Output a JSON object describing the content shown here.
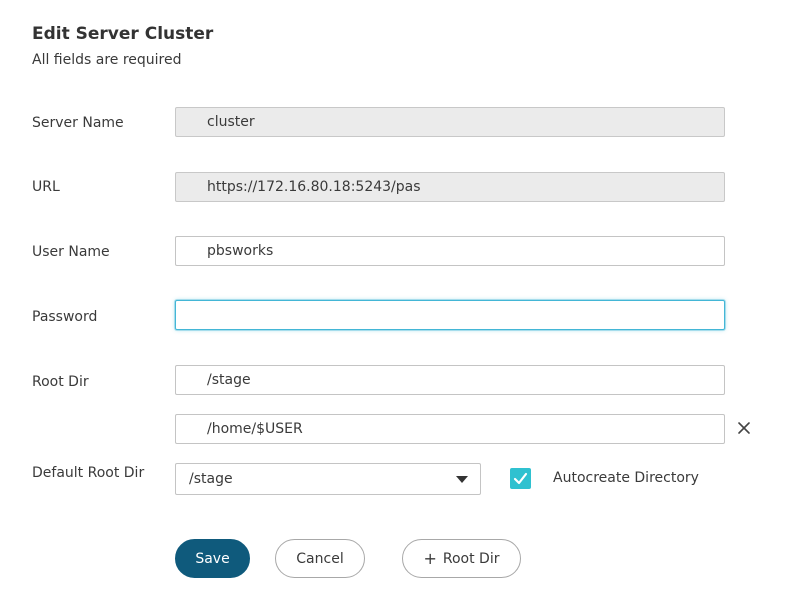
{
  "dialog": {
    "title": "Edit Server Cluster",
    "subtitle": "All fields are required"
  },
  "fields": {
    "server_name": {
      "label": "Server Name",
      "value": "cluster",
      "readonly": true
    },
    "url": {
      "label": "URL",
      "value": "https://172.16.80.18:5243/pas",
      "readonly": true
    },
    "user_name": {
      "label": "User Name",
      "value": "pbsworks"
    },
    "password": {
      "label": "Password",
      "value": ""
    },
    "root_dir": {
      "label": "Root Dir",
      "values": [
        "/stage",
        "/home/$USER"
      ],
      "remove_icon": "close-icon"
    },
    "default_root_dir": {
      "label": "Default Root Dir",
      "selected": "/stage",
      "dropdown_icon": "caret-down-icon"
    },
    "autocreate": {
      "label": "Autocreate Directory",
      "checked": true,
      "color": "#2fc1d0"
    }
  },
  "buttons": {
    "save": "Save",
    "cancel": "Cancel",
    "add_root_dir": "Root Dir",
    "add_root_dir_icon": "plus-icon"
  },
  "colors": {
    "primary": "#0f5a7c",
    "focus": "#43b6d6",
    "readonly_bg": "#ebebeb"
  }
}
